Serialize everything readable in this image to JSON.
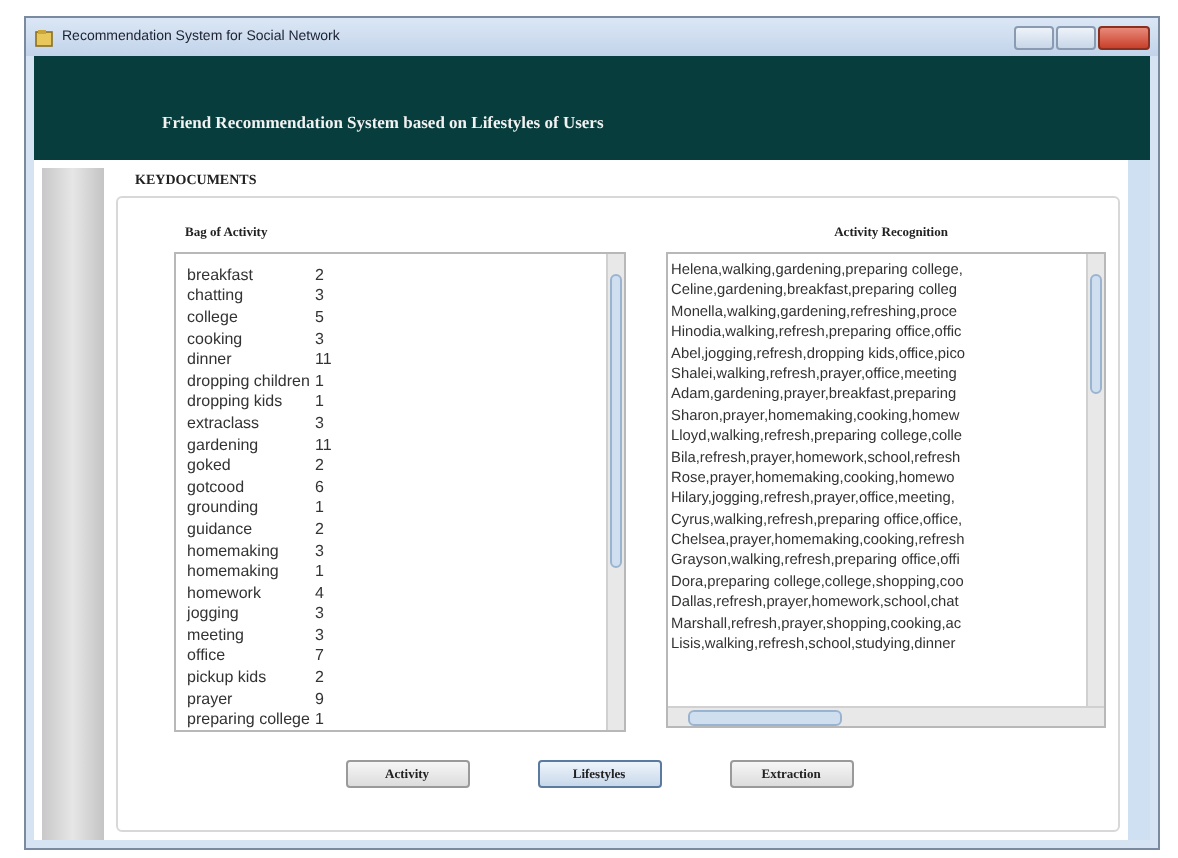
{
  "window": {
    "title": "Recommendation System for Social Network"
  },
  "banner": {
    "title": "Friend Recommendation System based on Lifestyles of Users"
  },
  "section": {
    "title": "KEYDOCUMENTS"
  },
  "bag_of_activity": {
    "label": "Bag of Activity",
    "rows": [
      {
        "name": "breakfast",
        "count": "2"
      },
      {
        "name": "chatting",
        "count": "3"
      },
      {
        "name": "college",
        "count": "5"
      },
      {
        "name": "cooking",
        "count": "3"
      },
      {
        "name": "dinner",
        "count": "11"
      },
      {
        "name": "dropping children",
        "count": "1"
      },
      {
        "name": "dropping kids",
        "count": "1"
      },
      {
        "name": "extraclass",
        "count": "3"
      },
      {
        "name": "gardening",
        "count": "11"
      },
      {
        "name": "goked",
        "count": "2"
      },
      {
        "name": "gotcood",
        "count": "6"
      },
      {
        "name": "grounding",
        "count": "1"
      },
      {
        "name": "guidance",
        "count": "2"
      },
      {
        "name": "homemaking",
        "count": "3"
      },
      {
        "name": "homemaking",
        "count": "1"
      },
      {
        "name": "homework",
        "count": "4"
      },
      {
        "name": "jogging",
        "count": "3"
      },
      {
        "name": "meeting",
        "count": "3"
      },
      {
        "name": "office",
        "count": "7"
      },
      {
        "name": "pickup kids",
        "count": "2"
      },
      {
        "name": "prayer",
        "count": "9"
      },
      {
        "name": "preparing college",
        "count": "1"
      }
    ]
  },
  "activity_recognition": {
    "label": "Activity Recognition",
    "lines": [
      "Helena,walking,gardening,preparing college,",
      "Celine,gardening,breakfast,preparing colleg",
      "Monella,walking,gardening,refreshing,proce",
      "Hinodia,walking,refresh,preparing office,offic",
      "Abel,jogging,refresh,dropping kids,office,pico",
      "Shalei,walking,refresh,prayer,office,meeting",
      "Adam,gardening,prayer,breakfast,preparing",
      "Sharon,prayer,homemaking,cooking,homew",
      "Lloyd,walking,refresh,preparing college,colle",
      "Bila,refresh,prayer,homework,school,refresh",
      "Rose,prayer,homemaking,cooking,homewo",
      "Hilary,jogging,refresh,prayer,office,meeting,",
      "Cyrus,walking,refresh,preparing office,office,",
      "Chelsea,prayer,homemaking,cooking,refresh",
      "Grayson,walking,refresh,preparing office,offi",
      "Dora,preparing college,college,shopping,coo",
      "Dallas,refresh,prayer,homework,school,chat",
      "Marshall,refresh,prayer,shopping,cooking,ac",
      "Lisis,walking,refresh,school,studying,dinner"
    ]
  },
  "buttons": [
    {
      "label": "Activity",
      "focused": false
    },
    {
      "label": "Lifestyles",
      "focused": true
    },
    {
      "label": "Extraction",
      "focused": false
    }
  ]
}
